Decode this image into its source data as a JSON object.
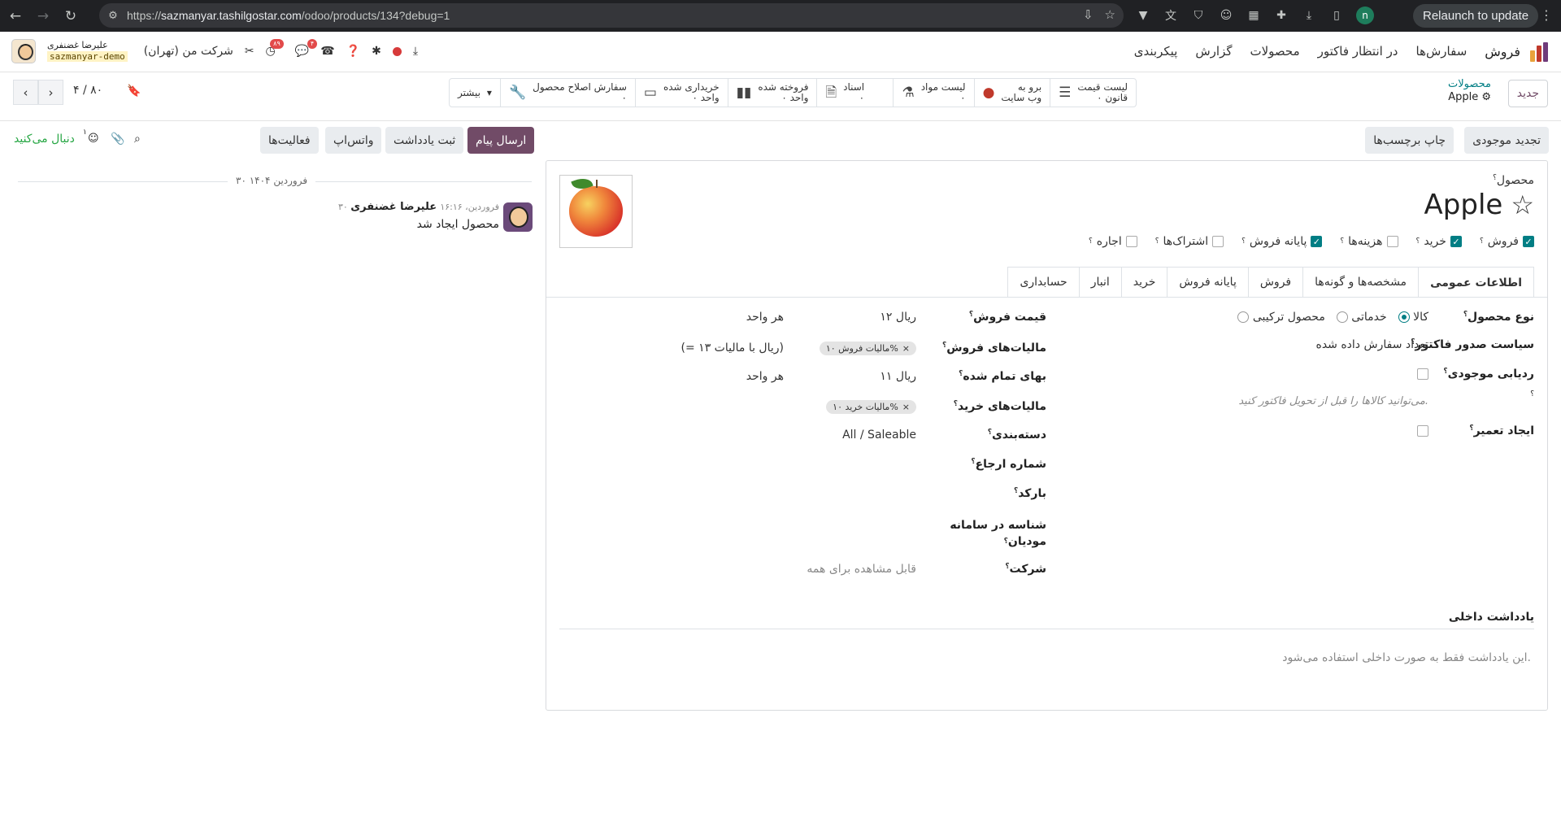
{
  "browser": {
    "url_prefix": "https://",
    "url_host": "sazmanyar.tashilgostar.com",
    "url_path": "/odoo/products/134?debug=1",
    "profile_initial": "n",
    "relaunch": "Relaunch to update"
  },
  "navbar": {
    "brand": "فروش",
    "menus": [
      "سفارش‌ها",
      "در انتظار فاکتور",
      "محصولات",
      "گزارش",
      "پیکربندی"
    ],
    "company": "شرکت من (تهران)",
    "user_name": "علیرضا غضنفری",
    "db_name": "sazmanyar-demo",
    "activity_badge": "۸۹",
    "chat_badge": "۴"
  },
  "control_panel": {
    "new_button": "جدید",
    "breadcrumb_parent": "محصولات",
    "breadcrumb_current": "Apple",
    "pager": "۴ / ۸۰",
    "stat_buttons": [
      {
        "line1": "لیست قیمت",
        "line2": "۰ قانون",
        "icon": "list-icon"
      },
      {
        "line1": "برو به",
        "line2": "وب سایت",
        "icon": "globe-icon"
      },
      {
        "line1": "لیست مواد",
        "line2": "۰",
        "icon": "flask-icon"
      },
      {
        "line1": "اسناد",
        "line2": "۰",
        "icon": "document-icon"
      },
      {
        "line1": "فروخته شده",
        "line2": "۰ واحد",
        "icon": "bar-chart-icon"
      },
      {
        "line1": "خریداری شده",
        "line2": "۰ واحد",
        "icon": "credit-card-icon"
      },
      {
        "line1": "سفارش اصلاح محصول",
        "line2": "۰",
        "icon": "wrench-icon"
      }
    ],
    "more": "بیشتر"
  },
  "form_buttons": {
    "update_qty": "تجدید موجودی",
    "print_labels": "چاپ برچسب‌ها"
  },
  "chatter_buttons": {
    "send_message": "ارسال پیام",
    "log_note": "ثبت یادداشت",
    "whatsapp": "واتس‌اپ",
    "activities": "فعالیت‌ها",
    "attachment_count": "۱",
    "following": "دنبال می‌کنید"
  },
  "product": {
    "label": "محصول",
    "name": "Apple",
    "checkboxes": [
      {
        "label": "فروش",
        "checked": true
      },
      {
        "label": "خرید",
        "checked": true
      },
      {
        "label": "هزینه‌ها",
        "checked": false
      },
      {
        "label": "پایانه فروش",
        "checked": true
      },
      {
        "label": "اشتراک‌ها",
        "checked": false
      },
      {
        "label": "اجاره",
        "checked": false
      }
    ]
  },
  "tabs": [
    "اطلاعات عمومی",
    "مشخصه‌ها و گونه‌ها",
    "فروش",
    "پایانه فروش",
    "خرید",
    "انبار",
    "حسابداری"
  ],
  "general": {
    "product_type_label": "نوع محصول",
    "product_type_options": [
      "کالا",
      "خدماتی",
      "محصول ترکیبی"
    ],
    "invoice_policy_label": "سیاست صدور فاکتور",
    "invoice_policy_value": "تعداد سفارش داده شده",
    "tracking_label": "ردیابی موجودی",
    "invoice_hint": "می‌توانید کالاها را قبل از تحویل فاکتور کنید.",
    "repair_label": "ایجاد تعمیر",
    "sales_price_label": "قیمت فروش",
    "sales_price_value": "۱۲ ریال",
    "sales_price_unit": "هر واحد",
    "sales_tax_label": "مالیات‌های فروش",
    "sales_tax_tag": "مالیات فروش ۱۰%",
    "tax_included_note": "(= ۱۳ ریال با مالیات)",
    "cost_label": "بهای تمام شده",
    "cost_value": "۱۱ ریال",
    "cost_unit": "هر واحد",
    "purchase_tax_label": "مالیات‌های خرید",
    "purchase_tax_tag": "مالیات خرید ۱۰%",
    "category_label": "دسته‌بندی",
    "category_value": "All / Saleable",
    "reference_label": "شماره ارجاع",
    "barcode_label": "بارکد",
    "moadian_label_1": "شناسه در سامانه",
    "moadian_label_2": "مودیان",
    "company_label": "شرکت",
    "company_placeholder": "قابل مشاهده برای همه",
    "internal_note_label": "یادداشت داخلی",
    "internal_note_placeholder": "این یادداشت فقط به صورت داخلی استفاده می‌شود."
  },
  "chatter": {
    "date": "۳۰ فروردین ۱۴۰۴",
    "author": "علیرضا غضنفری",
    "time": "۳۰ فروردین، ۱۶:۱۶",
    "body": "محصول ایجاد شد"
  }
}
